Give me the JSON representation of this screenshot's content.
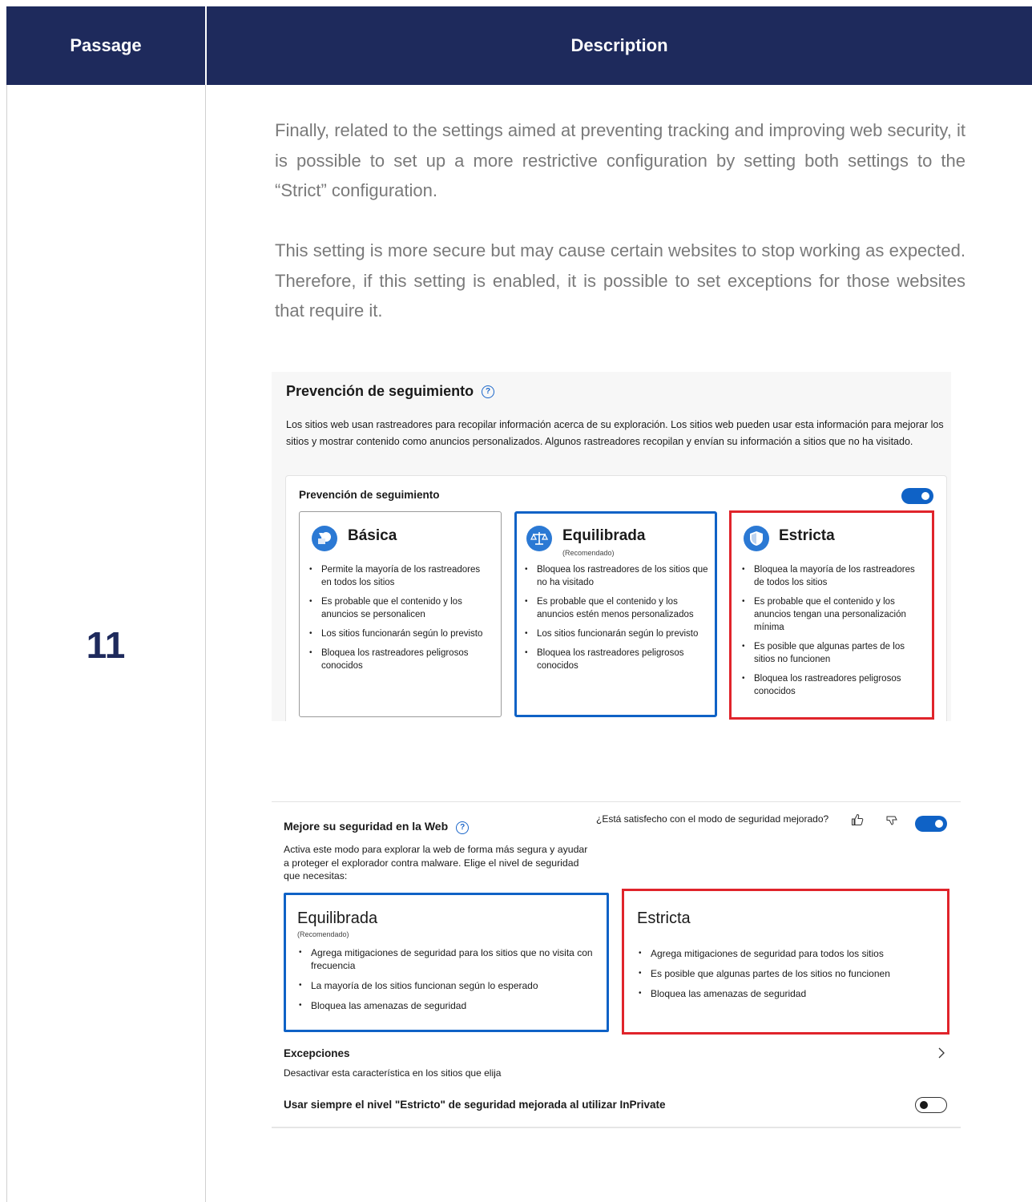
{
  "table": {
    "header": {
      "passage": "Passage",
      "description": "Description"
    },
    "passage_number": "11",
    "paragraphs": [
      "Finally, related to the settings aimed at preventing tracking and improving web security, it is possible to set up a more restrictive configuration by setting both settings to the “Strict” configuration.",
      "This setting is more secure but may cause certain websites to stop working as expected. Therefore, if this setting is enabled, it is possible to set exceptions for those websites that require it."
    ]
  },
  "tracking": {
    "title": "Prevención de seguimiento",
    "help_icon": "question-circle-icon",
    "description": "Los sitios web usan rastreadores para recopilar información acerca de su exploración. Los sitios web pueden usar esta información para mejorar los sitios y mostrar contenido como anuncios personalizados. Algunos rastreadores recopilan y envían su información a sitios que no ha visitado.",
    "toggle_label": "Prevención de seguimiento",
    "toggle_on": true,
    "cards": [
      {
        "title": "Básica",
        "subtitle": "",
        "icon": "basic-shapes-icon",
        "bullets": [
          "Permite la mayoría de los rastreadores en todos los sitios",
          "Es probable que el contenido y los anuncios se personalicen",
          "Los sitios funcionarán según lo previsto",
          "Bloquea los rastreadores peligrosos conocidos"
        ]
      },
      {
        "title": "Equilibrada",
        "subtitle": "(Recomendado)",
        "icon": "scale-icon",
        "bullets": [
          "Bloquea los rastreadores de los sitios que no ha visitado",
          "Es probable que el contenido y los anuncios estén menos personalizados",
          "Los sitios funcionarán según lo previsto",
          "Bloquea los rastreadores peligrosos conocidos"
        ]
      },
      {
        "title": "Estricta",
        "subtitle": "",
        "icon": "shield-icon",
        "bullets": [
          "Bloquea la mayoría de los rastreadores de todos los sitios",
          "Es probable que el contenido y los anuncios tengan una personalización mínima",
          "Es posible que algunas partes de los sitios no funcionen",
          "Bloquea los rastreadores peligrosos conocidos"
        ]
      }
    ]
  },
  "security": {
    "title": "Mejore su seguridad en la Web",
    "feedback_question": "¿Está satisfecho con el modo de seguridad mejorado?",
    "toggle_on": true,
    "description": "Activa este modo para explorar la web de forma más segura y ayudar a proteger el explorador contra malware. Elige el nivel de seguridad que necesitas:",
    "cards": [
      {
        "title": "Equilibrada",
        "subtitle": "(Recomendado)",
        "bullets": [
          "Agrega mitigaciones de seguridad para los sitios que no visita con frecuencia",
          "La mayoría de los sitios funcionan según lo esperado",
          "Bloquea las amenazas de seguridad"
        ]
      },
      {
        "title": "Estricta",
        "subtitle": "",
        "bullets": [
          "Agrega mitigaciones de seguridad para todos los sitios",
          "Es posible que algunas partes de los sitios no funcionen",
          "Bloquea las amenazas de seguridad"
        ]
      }
    ],
    "exceptions_title": "Excepciones",
    "exceptions_sub": "Desactivar esta característica en los sitios que elija",
    "inprivate_label": "Usar siempre el nivel \"Estricto\" de seguridad mejorada al utilizar InPrivate",
    "inprivate_on": false
  },
  "colors": {
    "header_bg": "#1e2a5c",
    "selected_blue": "#0f62c6",
    "highlight_red": "#e0242b",
    "text_gray": "#7a7a7a"
  }
}
